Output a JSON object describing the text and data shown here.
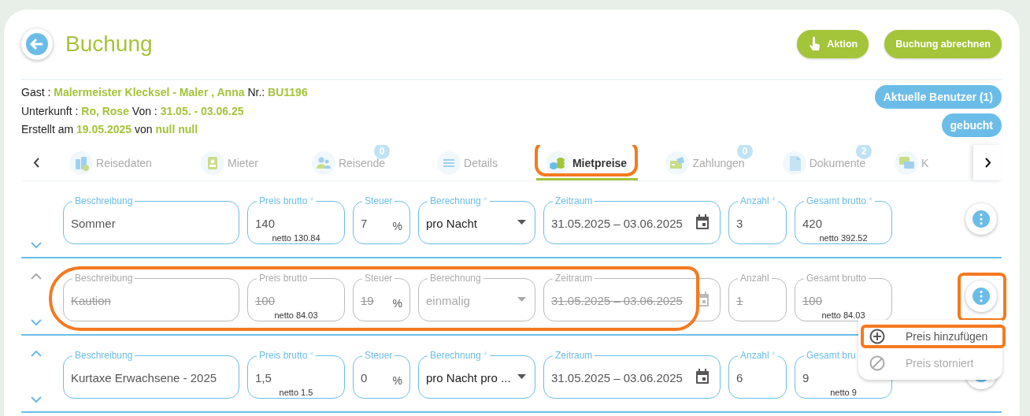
{
  "header": {
    "title": "Buchung",
    "actions": [
      {
        "label": "Aktion"
      },
      {
        "label": "Buchung abrechnen"
      }
    ]
  },
  "info": [
    [
      {
        "text": "Gast :",
        "accent": false
      },
      {
        "text": "Malermeister Klecksel - Maler , Anna",
        "accent": true
      },
      {
        "text": "Nr.:",
        "accent": false
      },
      {
        "text": "BU1196",
        "accent": true
      }
    ],
    [
      {
        "text": "Unterkunft :",
        "accent": false
      },
      {
        "text": "Ro, Rose",
        "accent": true
      },
      {
        "text": "Von :",
        "accent": false
      },
      {
        "text": "31.05. - 03.06.25",
        "accent": true
      }
    ],
    [
      {
        "text": "Erstellt am",
        "accent": false
      },
      {
        "text": "19.05.2025",
        "accent": true
      },
      {
        "text": "von",
        "accent": false
      },
      {
        "text": "null null",
        "accent": true
      }
    ]
  ],
  "status_buttons": [
    "Aktuelle Benutzer (1)",
    "gebucht"
  ],
  "tabs": [
    {
      "label": "Reisedaten",
      "selected": false,
      "highlighted": false
    },
    {
      "label": "Mieter",
      "selected": false,
      "highlighted": false
    },
    {
      "label": "Reisende",
      "badge": "0",
      "selected": false,
      "highlighted": false
    },
    {
      "label": "Details",
      "selected": false,
      "highlighted": false
    },
    {
      "label": "Mietpreise",
      "selected": true,
      "highlighted": true
    },
    {
      "label": "Zahlungen",
      "badge": "0",
      "selected": false,
      "highlighted": false
    },
    {
      "label": "Dokumente",
      "badge": "2",
      "selected": false,
      "highlighted": false
    },
    {
      "label": "K",
      "selected": false,
      "highlighted": false
    }
  ],
  "rows": [
    {
      "cancelled": false,
      "up_arrow": false,
      "down_arrow": true,
      "highlighted": false,
      "menu_highlighted": false,
      "fields": [
        {
          "kind": "text",
          "label": "Beschreibung",
          "value": "Sommer"
        },
        {
          "kind": "text",
          "label": "Preis brutto",
          "required_mark": "*",
          "value": "140",
          "netto": "netto 130.84"
        },
        {
          "kind": "percent",
          "label": "Steuer",
          "value": "7",
          "unit": "%"
        },
        {
          "kind": "select",
          "label": "Berechnung",
          "required_mark": "*",
          "value": "pro Nacht"
        },
        {
          "kind": "date",
          "label": "Zeitraum",
          "value": "31.05.2025 – 03.06.2025"
        },
        {
          "kind": "text",
          "label": "Anzahl",
          "required_mark": "*",
          "value": "3"
        },
        {
          "kind": "text",
          "label": "Gesamt brutto",
          "required_mark": "*",
          "value": "420",
          "netto": "netto 392.52"
        }
      ]
    },
    {
      "cancelled": true,
      "up_arrow": true,
      "down_arrow": true,
      "highlighted": true,
      "menu_highlighted": true,
      "fields": [
        {
          "kind": "text",
          "label": "Beschreibung",
          "value": "Kaution"
        },
        {
          "kind": "text",
          "label": "Preis brutto",
          "value": "100",
          "netto": "netto 84.03"
        },
        {
          "kind": "percent",
          "label": "Steuer",
          "value": "19",
          "unit": "%"
        },
        {
          "kind": "select",
          "label": "Berechnung",
          "value": "einmalig"
        },
        {
          "kind": "date",
          "label": "Zeitraum",
          "value": "31.05.2025 – 03.06.2025"
        },
        {
          "kind": "text",
          "label": "Anzahl",
          "value": "1"
        },
        {
          "kind": "text",
          "label": "Gesamt brutto",
          "value": "100",
          "netto": "netto 84.03"
        }
      ]
    },
    {
      "cancelled": false,
      "up_arrow": true,
      "down_arrow": true,
      "highlighted": false,
      "menu_highlighted": false,
      "fields": [
        {
          "kind": "text",
          "label": "Beschreibung",
          "value": "Kurtaxe Erwachsene - 2025"
        },
        {
          "kind": "text",
          "label": "Preis brutto",
          "required_mark": "*",
          "value": "1,5",
          "netto": "netto 1.5"
        },
        {
          "kind": "percent",
          "label": "Steuer",
          "value": "0",
          "unit": "%"
        },
        {
          "kind": "select",
          "label": "Berechnung",
          "required_mark": "*",
          "value": "pro Nacht pro ..."
        },
        {
          "kind": "date",
          "label": "Zeitraum",
          "value": "31.05.2025 – 03.06.2025"
        },
        {
          "kind": "text",
          "label": "Anzahl",
          "required_mark": "*",
          "value": "6"
        },
        {
          "kind": "text",
          "label": "Gesamt bru",
          "value": "9",
          "netto": "netto 9"
        }
      ]
    }
  ],
  "menu": {
    "items": [
      {
        "label": "Preis hinzufügen",
        "disabled": false,
        "highlighted": true
      },
      {
        "label": "Preis storniert",
        "disabled": true,
        "highlighted": false
      }
    ]
  }
}
